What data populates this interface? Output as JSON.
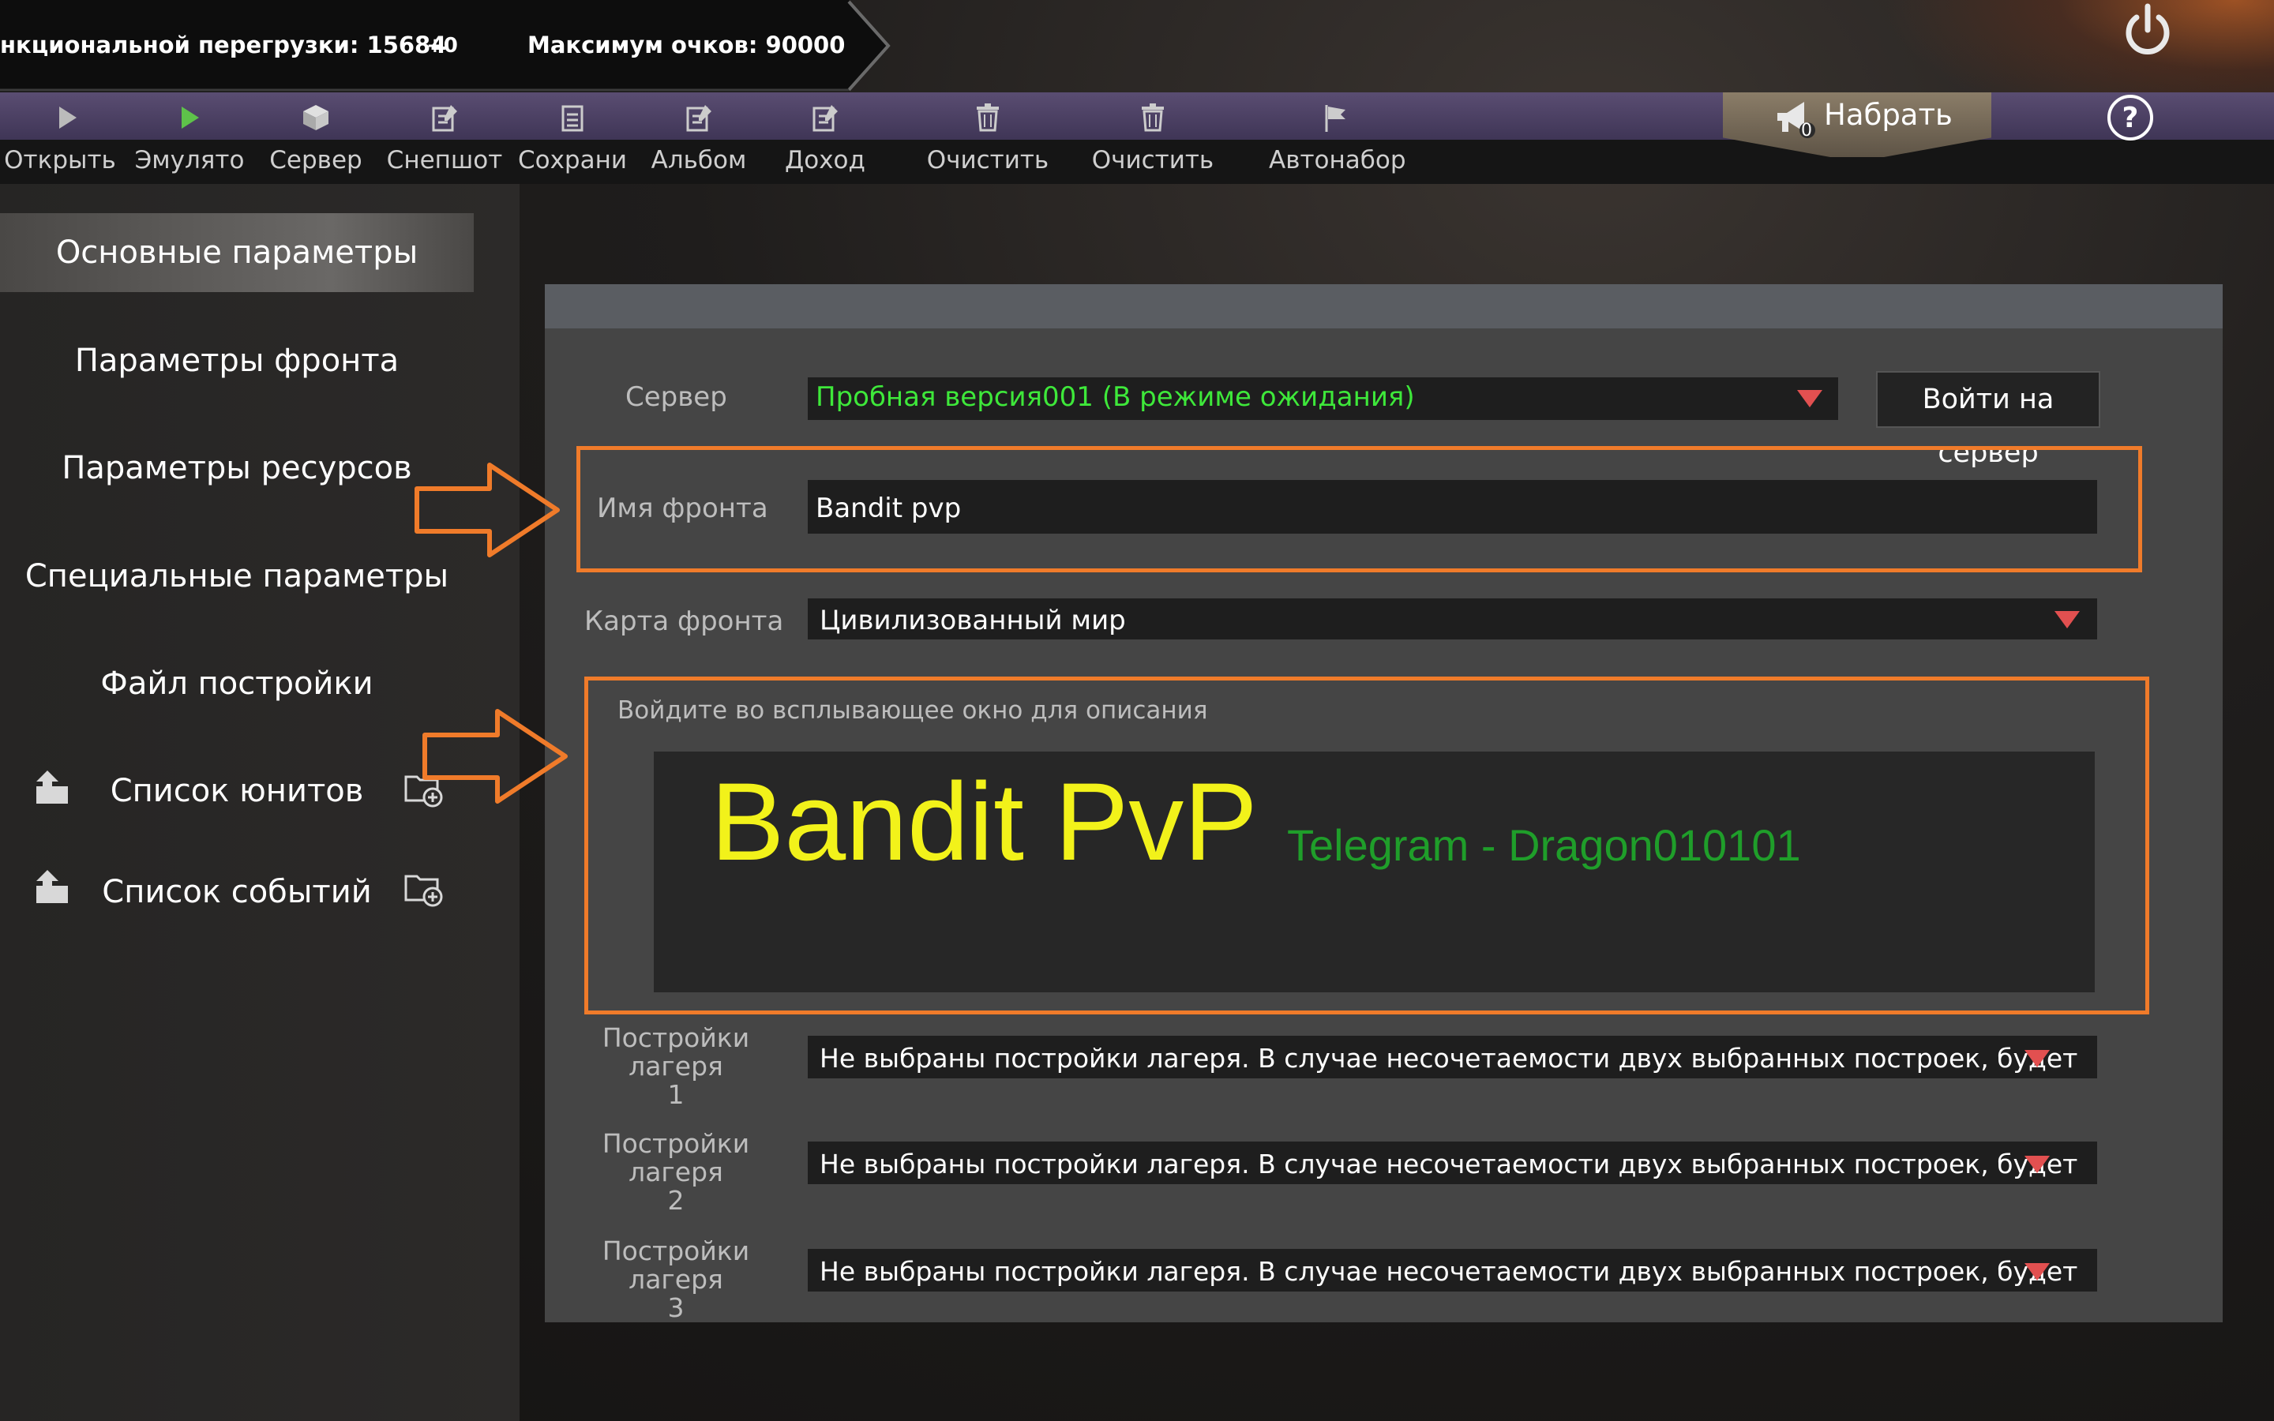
{
  "status": {
    "overload_label": "нкциональной перегрузки: 15684",
    "overload_delta": "+0",
    "max_points": "Максимум очков: 90000"
  },
  "toolbar": {
    "items": [
      {
        "label": "Открыть",
        "icon": "play-icon",
        "color": "#bbbbbb"
      },
      {
        "label": "Эмулято",
        "icon": "play-icon",
        "color": "#5ec24a"
      },
      {
        "label": "Сервер",
        "icon": "cube-icon",
        "color": "#cccccc"
      },
      {
        "label": "Снепшот",
        "icon": "edit-icon",
        "color": "#cccccc"
      },
      {
        "label": "Сохрани",
        "icon": "document-icon",
        "color": "#cccccc"
      },
      {
        "label": "Альбом",
        "icon": "edit-icon",
        "color": "#cccccc"
      },
      {
        "label": "Доход",
        "icon": "edit-icon",
        "color": "#cccccc"
      },
      {
        "label": "Очистить",
        "icon": "trash-icon",
        "color": "#cccccc"
      },
      {
        "label": "Очистить",
        "icon": "trash-icon",
        "color": "#cccccc"
      },
      {
        "label": "Автонабор",
        "icon": "flag-icon",
        "color": "#cccccc"
      }
    ],
    "nabrat_label": "Набрать",
    "nabrat_badge": "0"
  },
  "sidebar": {
    "items": [
      {
        "label": "Основные параметры",
        "active": true
      },
      {
        "label": "Параметры фронта"
      },
      {
        "label": "Параметры ресурсов"
      },
      {
        "label": "Специальные параметры"
      },
      {
        "label": "Файл постройки"
      },
      {
        "label": "Список юнитов"
      },
      {
        "label": "Список событий"
      }
    ]
  },
  "form": {
    "server_label": "Сервер",
    "server_value": "Пробная версия001 (В режиме ожидания)",
    "server_value_color": "#3ee83a",
    "enter_server": "Войти на сервер",
    "front_name_label": "Имя фронта",
    "front_name_value": "Bandit pvp",
    "front_map_label": "Карта фронта",
    "front_map_value": "Цивилизованный мир",
    "desc_hint": "Войдите во всплывающее окно для описания",
    "desc_title": "Bandit PvP",
    "desc_title_color": "#f2f21a",
    "desc_sub": "Telegram - Dragon010101",
    "desc_sub_color": "#1f9e2a",
    "camp": [
      {
        "label_line1": "Постройки лагеря",
        "label_line2": "1",
        "value": "Не выбраны постройки лагеря. В случае несочетаемости двух выбранных построек, будет"
      },
      {
        "label_line1": "Постройки лагеря",
        "label_line2": "2",
        "value": "Не выбраны постройки лагеря. В случае несочетаемости двух выбранных построек, будет"
      },
      {
        "label_line1": "Постройки лагеря",
        "label_line2": "3",
        "value": "Не выбраны постройки лагеря. В случае несочетаемости двух выбранных построек, будет"
      }
    ]
  },
  "highlight_color": "#f07b2a"
}
